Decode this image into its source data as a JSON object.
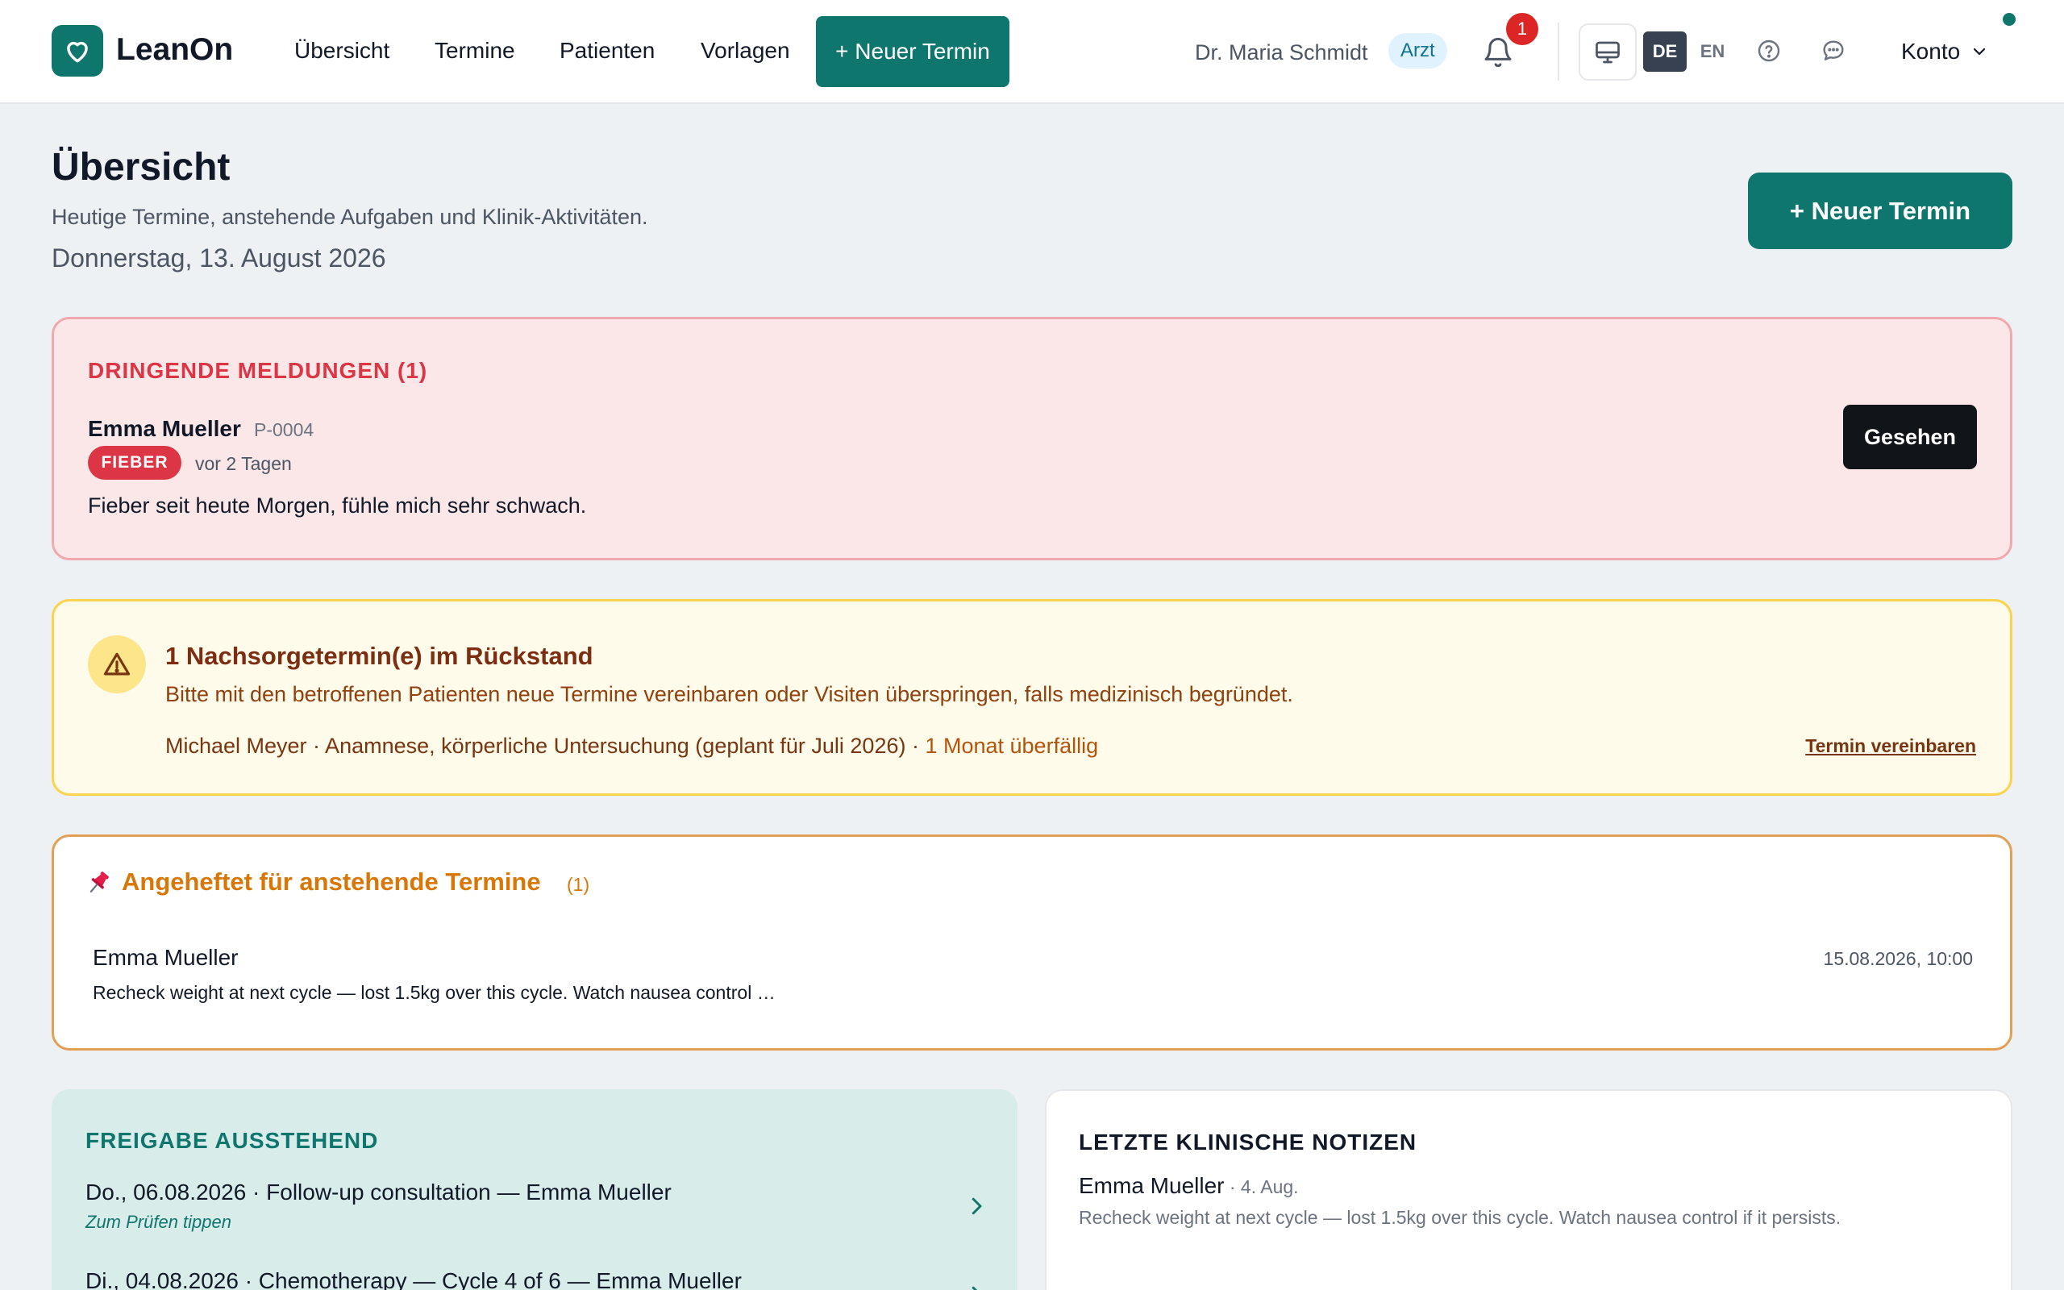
{
  "header": {
    "app_name": "LeanOn",
    "nav": [
      {
        "label": "Übersicht"
      },
      {
        "label": "Termine"
      },
      {
        "label": "Patienten"
      },
      {
        "label": "Vorlagen"
      }
    ],
    "new_appointment": "+ Neuer Termin",
    "user_name": "Dr. Maria Schmidt",
    "role": "Arzt",
    "notification_count": "1",
    "lang_active": "DE",
    "lang_other": "EN",
    "account": "Konto"
  },
  "page": {
    "title": "Übersicht",
    "subtitle": "Heutige Termine, anstehende Aufgaben und Klinik-Aktivitäten.",
    "date": "Donnerstag, 13. August 2026",
    "new_appointment": "+ Neuer Termin"
  },
  "urgent": {
    "title": "DRINGENDE MELDUNGEN (1)",
    "patient_name": "Emma Mueller",
    "patient_id": "P-0004",
    "tag": "FIEBER",
    "time": "vor 2 Tagen",
    "message": "Fieber seit heute Morgen, fühle mich sehr schwach.",
    "seen_button": "Gesehen"
  },
  "overdue": {
    "title": "1 Nachsorgetermin(e) im Rückstand",
    "description": "Bitte mit den betroffenen Patienten neue Termine vereinbaren oder Visiten überspringen, falls medizinisch begründet.",
    "item_text": "Michael Meyer · Anamnese, körperliche Untersuchung (geplant für Juli 2026) · ",
    "item_late": "1 Monat überfällig",
    "link": "Termin vereinbaren"
  },
  "pinned": {
    "title": "Angeheftet für anstehende Termine",
    "count": "(1)",
    "patient_name": "Emma Mueller",
    "datetime": "15.08.2026, 10:00",
    "note": "Recheck weight at next cycle — lost 1.5kg over this cycle. Watch nausea control …"
  },
  "pending": {
    "title": "FREIGABE AUSSTEHEND",
    "items": [
      {
        "text": "Do., 06.08.2026 · Follow-up consultation — Emma Mueller",
        "hint": "Zum Prüfen tippen"
      },
      {
        "text": "Di., 04.08.2026 · Chemotherapy — Cycle 4 of 6 — Emma Mueller",
        "hint": ""
      }
    ]
  },
  "notes": {
    "title": "LETZTE KLINISCHE NOTIZEN",
    "patient_name": "Emma Mueller",
    "date": " · 4. Aug.",
    "text": "Recheck weight at next cycle — lost 1.5kg over this cycle. Watch nausea control if it persists."
  },
  "colors": {
    "brand": "#0f766e",
    "urgent": "#dc3545",
    "warning": "#fcd34d",
    "pinned": "#d97706"
  }
}
